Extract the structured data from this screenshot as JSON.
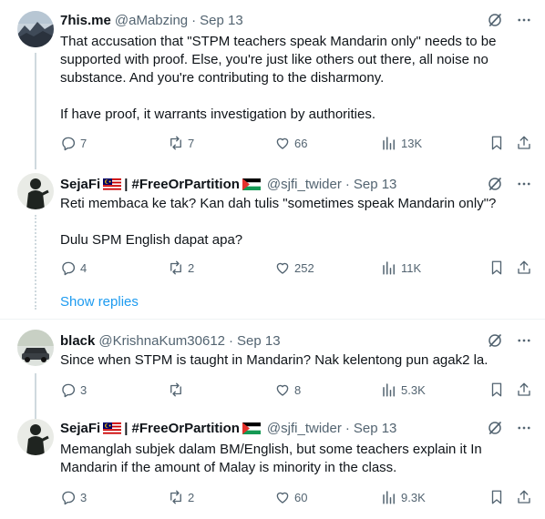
{
  "tweets": [
    {
      "name": "7his.me",
      "handle": "@aMabzing",
      "sep": "·",
      "date": "Sep 13",
      "paragraphs": [
        "That accusation that \"STPM teachers speak Mandarin only\" needs to be supported with proof. Else, you're just like others out there, all noise no substance. And you're contributing to the disharmony.",
        "If have proof, it warrants investigation by authorities."
      ],
      "replies": "7",
      "reposts": "7",
      "likes": "66",
      "views": "13K"
    },
    {
      "name": "SejaFi",
      "name_suffix": "| #FreeOrPartition",
      "handle": "@sjfi_twider",
      "sep": "·",
      "date": "Sep 13",
      "paragraphs": [
        "Reti membaca ke tak? Kan dah tulis \"sometimes speak Mandarin only\"?",
        "Dulu SPM English dapat apa?"
      ],
      "replies": "4",
      "reposts": "2",
      "likes": "252",
      "views": "11K"
    },
    {
      "name": "black",
      "handle": "@KrishnaKum30612",
      "sep": "·",
      "date": "Sep 13",
      "paragraphs": [
        "Since when STPM is taught in Mandarin? Nak kelentong pun agak2 la."
      ],
      "replies": "3",
      "reposts": "",
      "likes": "8",
      "views": "5.3K"
    },
    {
      "name": "SejaFi",
      "name_suffix": "| #FreeOrPartition",
      "handle": "@sjfi_twider",
      "sep": "·",
      "date": "Sep 13",
      "paragraphs": [
        "Memanglah subjek dalam BM/English, but some teachers explain it In Mandarin if the amount of Malay is minority in the class."
      ],
      "replies": "3",
      "reposts": "2",
      "likes": "60",
      "views": "9.3K"
    }
  ],
  "show_replies": "Show replies",
  "icons": {
    "reply": "reply-icon",
    "repost": "repost-icon",
    "like": "heart-icon",
    "views": "views-icon",
    "bookmark": "bookmark-icon",
    "share": "share-icon",
    "grok": "grok-icon",
    "more": "more-icon",
    "flag_my": "malaysia-flag-icon",
    "flag_ps": "palestine-flag-icon"
  },
  "colors": {
    "text": "#0f1419",
    "secondary": "#536471",
    "link": "#1d9bf0",
    "line": "#cfd9de"
  }
}
